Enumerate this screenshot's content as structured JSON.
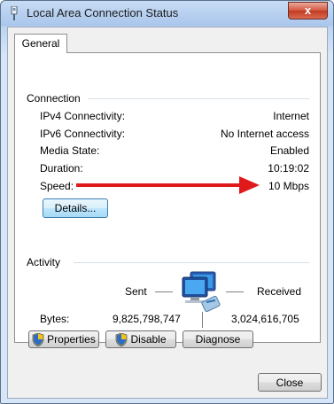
{
  "window": {
    "title": "Local Area Connection Status",
    "close_label": "x"
  },
  "tabs": [
    {
      "label": "General"
    }
  ],
  "connection": {
    "group_label": "Connection",
    "rows": [
      {
        "label": "IPv4 Connectivity:",
        "value": "Internet"
      },
      {
        "label": "IPv6 Connectivity:",
        "value": "No Internet access"
      },
      {
        "label": "Media State:",
        "value": "Enabled"
      },
      {
        "label": "Duration:",
        "value": "10:19:02"
      },
      {
        "label": "Speed:",
        "value": "10 Mbps"
      }
    ],
    "details_button": "Details..."
  },
  "annotation": {
    "arrow_color": "#e0191b"
  },
  "activity": {
    "group_label": "Activity",
    "sent_label": "Sent",
    "received_label": "Received",
    "bytes_label": "Bytes:",
    "bytes_sent": "9,825,798,747",
    "bytes_received": "3,024,616,705"
  },
  "buttons": {
    "properties": "Properties",
    "disable": "Disable",
    "diagnose": "Diagnose",
    "close": "Close"
  },
  "icons": {
    "title": "network-plug-icon",
    "activity": "network-computers-icon",
    "uac": "uac-shield-icon"
  }
}
